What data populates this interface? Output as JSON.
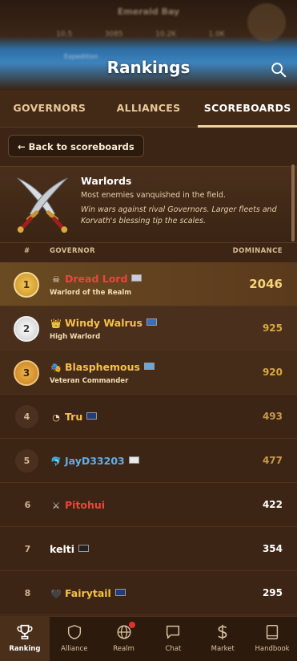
{
  "header": {
    "blurred_top_title": "Emerald Bay",
    "blurred_stats": [
      "10.5",
      "3085",
      "10.2K",
      "1.0K"
    ],
    "blurred_location": "Expedition",
    "page_title": "Rankings"
  },
  "tabs": [
    {
      "label": "GOVERNORS",
      "active": false
    },
    {
      "label": "ALLIANCES",
      "active": false
    },
    {
      "label": "SCOREBOARDS",
      "active": true
    }
  ],
  "back_button": "← Back to scoreboards",
  "board": {
    "icon": "crossed-swords-icon",
    "title": "Warlords",
    "subtitle": "Most enemies vanquished in the field.",
    "description": "Win wars against rival Governors. Larger fleets and Korvath's blessing tip the scales."
  },
  "columns": {
    "rank": "#",
    "governor": "GOVERNOR",
    "score": "DOMINANCE"
  },
  "rows": [
    {
      "rank": "1",
      "prefix": "☠",
      "name": "Dread Lord",
      "subtitle": "Warlord of the Realm",
      "score": "2046",
      "name_color": "#e8473c"
    },
    {
      "rank": "2",
      "prefix": "👑",
      "name": "Windy Walrus",
      "subtitle": "High Warlord",
      "score": "925",
      "name_color": "#f6c04a"
    },
    {
      "rank": "3",
      "prefix": "🎭",
      "name": "Blasphemous",
      "subtitle": "Veteran Commander",
      "score": "920",
      "name_color": "#f6c04a"
    },
    {
      "rank": "4",
      "prefix": "◔",
      "name": "Tru",
      "subtitle": "",
      "score": "493",
      "name_color": "#f6c04a"
    },
    {
      "rank": "5",
      "prefix": "🐬",
      "name": "JayD33203",
      "subtitle": "",
      "score": "477",
      "name_color": "#5aaef0"
    },
    {
      "rank": "6",
      "prefix": "⚔",
      "name": "Pitohui",
      "subtitle": "",
      "score": "422",
      "name_color": "#e8473c"
    },
    {
      "rank": "7",
      "prefix": "",
      "name": "kelti",
      "subtitle": "",
      "score": "354",
      "name_color": "#ffffff"
    },
    {
      "rank": "8",
      "prefix": "🖤",
      "name": "Fairytail",
      "subtitle": "",
      "score": "295",
      "name_color": "#f6c04a"
    }
  ],
  "nav": [
    {
      "label": "Ranking",
      "icon": "trophy-icon",
      "active": true
    },
    {
      "label": "Alliance",
      "icon": "shield-icon",
      "active": false
    },
    {
      "label": "Realm",
      "icon": "globe-icon",
      "active": false,
      "notification": true
    },
    {
      "label": "Chat",
      "icon": "chat-bubble-icon",
      "active": false
    },
    {
      "label": "Market",
      "icon": "dollar-icon",
      "active": false
    },
    {
      "label": "Handbook",
      "icon": "book-icon",
      "active": false
    }
  ]
}
